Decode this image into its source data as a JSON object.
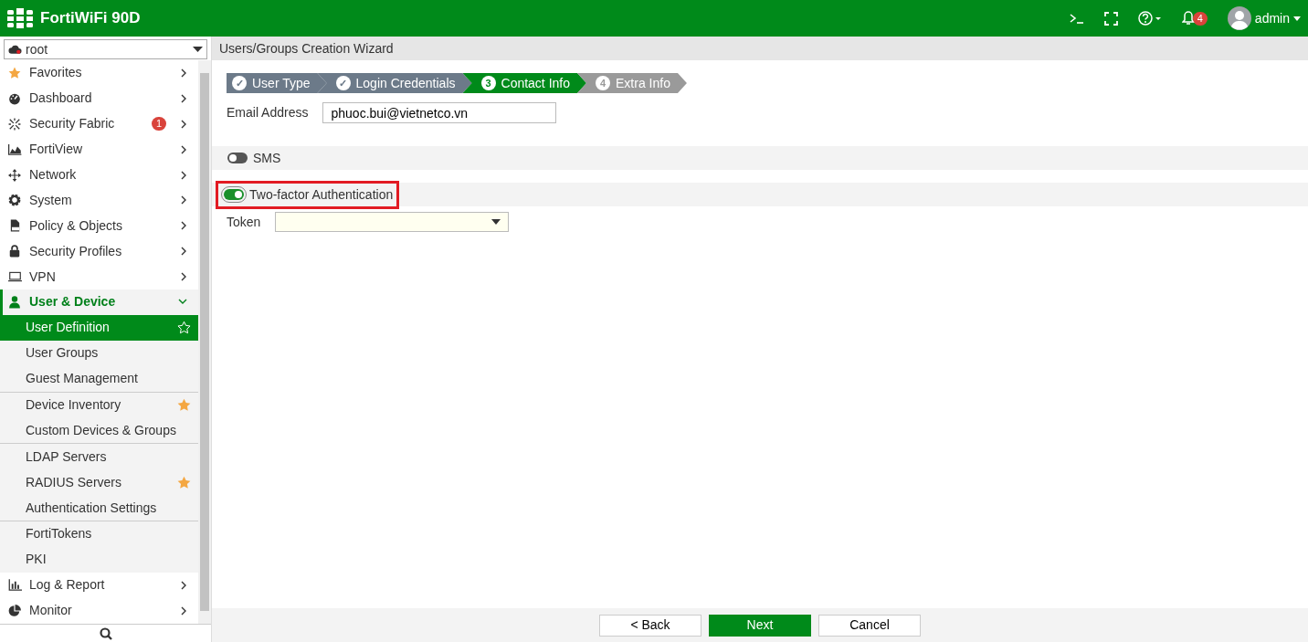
{
  "header": {
    "product": "FortiWiFi 90D",
    "notification_count": "4",
    "user": "admin"
  },
  "sidebar": {
    "vdom": "root",
    "items": [
      {
        "label": "Favorites",
        "expanded": false
      },
      {
        "label": "Dashboard",
        "expanded": false
      },
      {
        "label": "Security Fabric",
        "badge": "1",
        "expanded": false
      },
      {
        "label": "FortiView",
        "expanded": false
      },
      {
        "label": "Network",
        "expanded": false
      },
      {
        "label": "System",
        "expanded": false
      },
      {
        "label": "Policy & Objects",
        "expanded": false
      },
      {
        "label": "Security Profiles",
        "expanded": false
      },
      {
        "label": "VPN",
        "expanded": false
      },
      {
        "label": "User & Device",
        "expanded": true,
        "child_groups": [
          [
            {
              "label": "User Definition",
              "selected": true,
              "starred": false
            },
            {
              "label": "User Groups",
              "selected": false,
              "starred": false
            },
            {
              "label": "Guest Management",
              "selected": false,
              "starred": false
            }
          ],
          [
            {
              "label": "Device Inventory",
              "selected": false,
              "starred": true
            },
            {
              "label": "Custom Devices & Groups",
              "selected": false,
              "starred": false
            }
          ],
          [
            {
              "label": "LDAP Servers",
              "selected": false,
              "starred": false
            },
            {
              "label": "RADIUS Servers",
              "selected": false,
              "starred": true
            },
            {
              "label": "Authentication Settings",
              "selected": false,
              "starred": false
            }
          ],
          [
            {
              "label": "FortiTokens",
              "selected": false,
              "starred": false
            },
            {
              "label": "PKI",
              "selected": false,
              "starred": false
            }
          ]
        ]
      },
      {
        "label": "Log & Report",
        "expanded": false
      },
      {
        "label": "Monitor",
        "expanded": false
      }
    ]
  },
  "page_title": "Users/Groups Creation Wizard",
  "steps": [
    {
      "marker": "✓",
      "label": "User Type",
      "kind": "done"
    },
    {
      "marker": "✓",
      "label": "Login Credentials",
      "kind": "done"
    },
    {
      "marker": "3",
      "label": "Contact Info",
      "kind": "current"
    },
    {
      "marker": "4",
      "label": "Extra Info",
      "kind": "todo"
    }
  ],
  "email": {
    "label": "Email Address",
    "value": "phuoc.bui@vietnetco.vn"
  },
  "toggles": [
    {
      "label": "SMS",
      "on": false,
      "highlighted": false
    },
    {
      "label": "Two-factor Authentication",
      "on": true,
      "highlighted": true
    }
  ],
  "token": {
    "label": "Token"
  },
  "buttons": [
    {
      "label": "< Back",
      "primary": false
    },
    {
      "label": "Next",
      "primary": true
    },
    {
      "label": "Cancel",
      "primary": false
    }
  ]
}
